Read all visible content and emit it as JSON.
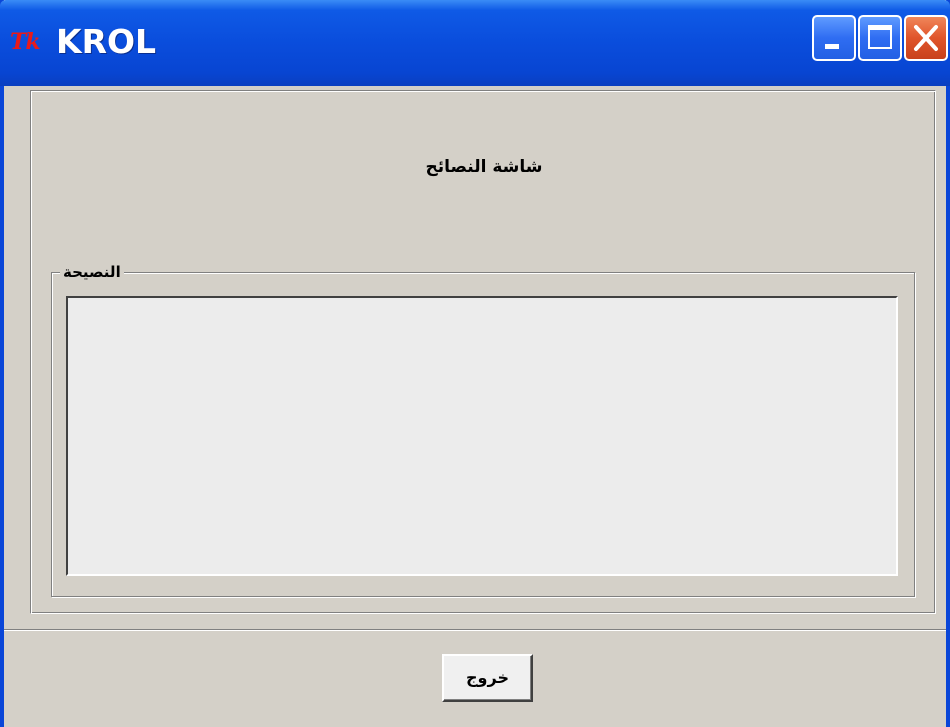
{
  "window": {
    "title": "KROL",
    "app_icon": "tk-feather-icon",
    "app_icon_text": "Tk",
    "accent_color": "#0a46d8",
    "controls": {
      "minimize": "minimize-icon",
      "maximize": "maximize-icon",
      "close": "close-icon"
    }
  },
  "main": {
    "screen_title": "شاشة النصائح",
    "advice_group": {
      "legend": "النصيحة",
      "text": ""
    },
    "exit_button_label": "خروج"
  }
}
